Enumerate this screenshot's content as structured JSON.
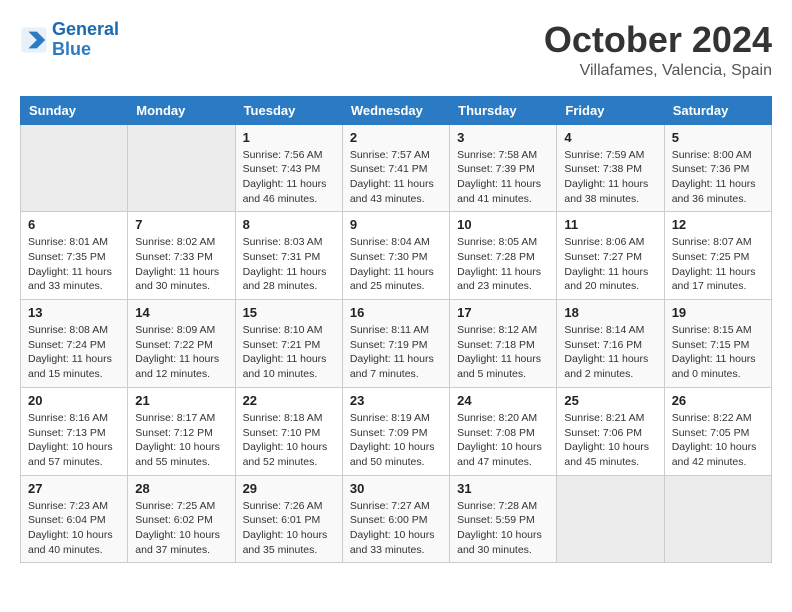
{
  "header": {
    "logo_line1": "General",
    "logo_line2": "Blue",
    "month": "October 2024",
    "location": "Villafames, Valencia, Spain"
  },
  "columns": [
    "Sunday",
    "Monday",
    "Tuesday",
    "Wednesday",
    "Thursday",
    "Friday",
    "Saturday"
  ],
  "weeks": [
    [
      {
        "day": "",
        "info": ""
      },
      {
        "day": "",
        "info": ""
      },
      {
        "day": "1",
        "info": "Sunrise: 7:56 AM\nSunset: 7:43 PM\nDaylight: 11 hours and 46 minutes."
      },
      {
        "day": "2",
        "info": "Sunrise: 7:57 AM\nSunset: 7:41 PM\nDaylight: 11 hours and 43 minutes."
      },
      {
        "day": "3",
        "info": "Sunrise: 7:58 AM\nSunset: 7:39 PM\nDaylight: 11 hours and 41 minutes."
      },
      {
        "day": "4",
        "info": "Sunrise: 7:59 AM\nSunset: 7:38 PM\nDaylight: 11 hours and 38 minutes."
      },
      {
        "day": "5",
        "info": "Sunrise: 8:00 AM\nSunset: 7:36 PM\nDaylight: 11 hours and 36 minutes."
      }
    ],
    [
      {
        "day": "6",
        "info": "Sunrise: 8:01 AM\nSunset: 7:35 PM\nDaylight: 11 hours and 33 minutes."
      },
      {
        "day": "7",
        "info": "Sunrise: 8:02 AM\nSunset: 7:33 PM\nDaylight: 11 hours and 30 minutes."
      },
      {
        "day": "8",
        "info": "Sunrise: 8:03 AM\nSunset: 7:31 PM\nDaylight: 11 hours and 28 minutes."
      },
      {
        "day": "9",
        "info": "Sunrise: 8:04 AM\nSunset: 7:30 PM\nDaylight: 11 hours and 25 minutes."
      },
      {
        "day": "10",
        "info": "Sunrise: 8:05 AM\nSunset: 7:28 PM\nDaylight: 11 hours and 23 minutes."
      },
      {
        "day": "11",
        "info": "Sunrise: 8:06 AM\nSunset: 7:27 PM\nDaylight: 11 hours and 20 minutes."
      },
      {
        "day": "12",
        "info": "Sunrise: 8:07 AM\nSunset: 7:25 PM\nDaylight: 11 hours and 17 minutes."
      }
    ],
    [
      {
        "day": "13",
        "info": "Sunrise: 8:08 AM\nSunset: 7:24 PM\nDaylight: 11 hours and 15 minutes."
      },
      {
        "day": "14",
        "info": "Sunrise: 8:09 AM\nSunset: 7:22 PM\nDaylight: 11 hours and 12 minutes."
      },
      {
        "day": "15",
        "info": "Sunrise: 8:10 AM\nSunset: 7:21 PM\nDaylight: 11 hours and 10 minutes."
      },
      {
        "day": "16",
        "info": "Sunrise: 8:11 AM\nSunset: 7:19 PM\nDaylight: 11 hours and 7 minutes."
      },
      {
        "day": "17",
        "info": "Sunrise: 8:12 AM\nSunset: 7:18 PM\nDaylight: 11 hours and 5 minutes."
      },
      {
        "day": "18",
        "info": "Sunrise: 8:14 AM\nSunset: 7:16 PM\nDaylight: 11 hours and 2 minutes."
      },
      {
        "day": "19",
        "info": "Sunrise: 8:15 AM\nSunset: 7:15 PM\nDaylight: 11 hours and 0 minutes."
      }
    ],
    [
      {
        "day": "20",
        "info": "Sunrise: 8:16 AM\nSunset: 7:13 PM\nDaylight: 10 hours and 57 minutes."
      },
      {
        "day": "21",
        "info": "Sunrise: 8:17 AM\nSunset: 7:12 PM\nDaylight: 10 hours and 55 minutes."
      },
      {
        "day": "22",
        "info": "Sunrise: 8:18 AM\nSunset: 7:10 PM\nDaylight: 10 hours and 52 minutes."
      },
      {
        "day": "23",
        "info": "Sunrise: 8:19 AM\nSunset: 7:09 PM\nDaylight: 10 hours and 50 minutes."
      },
      {
        "day": "24",
        "info": "Sunrise: 8:20 AM\nSunset: 7:08 PM\nDaylight: 10 hours and 47 minutes."
      },
      {
        "day": "25",
        "info": "Sunrise: 8:21 AM\nSunset: 7:06 PM\nDaylight: 10 hours and 45 minutes."
      },
      {
        "day": "26",
        "info": "Sunrise: 8:22 AM\nSunset: 7:05 PM\nDaylight: 10 hours and 42 minutes."
      }
    ],
    [
      {
        "day": "27",
        "info": "Sunrise: 7:23 AM\nSunset: 6:04 PM\nDaylight: 10 hours and 40 minutes."
      },
      {
        "day": "28",
        "info": "Sunrise: 7:25 AM\nSunset: 6:02 PM\nDaylight: 10 hours and 37 minutes."
      },
      {
        "day": "29",
        "info": "Sunrise: 7:26 AM\nSunset: 6:01 PM\nDaylight: 10 hours and 35 minutes."
      },
      {
        "day": "30",
        "info": "Sunrise: 7:27 AM\nSunset: 6:00 PM\nDaylight: 10 hours and 33 minutes."
      },
      {
        "day": "31",
        "info": "Sunrise: 7:28 AM\nSunset: 5:59 PM\nDaylight: 10 hours and 30 minutes."
      },
      {
        "day": "",
        "info": ""
      },
      {
        "day": "",
        "info": ""
      }
    ]
  ]
}
